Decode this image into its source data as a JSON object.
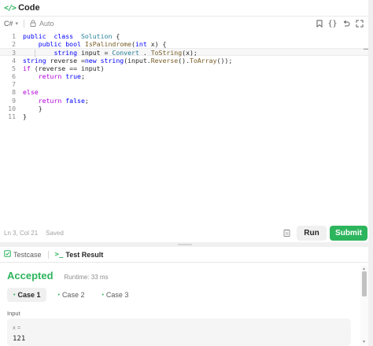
{
  "header": {
    "icon": "code-icon",
    "icon_glyph": "</>",
    "title": "Code"
  },
  "toolbar": {
    "language": "C#",
    "mode": "Auto",
    "icons": [
      "bookmark-icon",
      "braces-icon",
      "undo-icon",
      "expand-icon"
    ]
  },
  "editor": {
    "lines": [
      {
        "n": "1",
        "segs": [
          [
            "kw",
            "public"
          ],
          [
            "",
            "  "
          ],
          [
            "kw",
            "class"
          ],
          [
            "",
            "  "
          ],
          [
            "ty",
            "Solution"
          ],
          [
            "",
            " {"
          ]
        ]
      },
      {
        "n": "2",
        "segs": [
          [
            "",
            "    "
          ],
          [
            "kw",
            "public"
          ],
          [
            "",
            " "
          ],
          [
            "kw",
            "bool"
          ],
          [
            "",
            " "
          ],
          [
            "fn",
            "IsPalindrome"
          ],
          [
            "",
            "("
          ],
          [
            "kw",
            "int"
          ],
          [
            "",
            " x) {"
          ]
        ]
      },
      {
        "n": "3",
        "segs": [
          [
            "",
            "        "
          ],
          [
            "kw",
            "string"
          ],
          [
            "",
            " input = "
          ],
          [
            "ty",
            "Convert"
          ],
          [
            "",
            " . "
          ],
          [
            "fn",
            "ToString"
          ],
          [
            "",
            "(x);"
          ]
        ]
      },
      {
        "n": "4",
        "segs": [
          [
            "kw",
            "string"
          ],
          [
            "",
            " reverse ="
          ],
          [
            "kw",
            "new"
          ],
          [
            "",
            " "
          ],
          [
            "kw",
            "string"
          ],
          [
            "",
            "(input."
          ],
          [
            "fn",
            "Reverse"
          ],
          [
            "",
            "()."
          ],
          [
            "fn",
            "ToArray"
          ],
          [
            "",
            "());"
          ]
        ]
      },
      {
        "n": "5",
        "segs": [
          [
            "kw2",
            "if"
          ],
          [
            "",
            " (reverse == input)"
          ]
        ]
      },
      {
        "n": "6",
        "segs": [
          [
            "",
            "    "
          ],
          [
            "kw2",
            "return"
          ],
          [
            "",
            " "
          ],
          [
            "kw",
            "true"
          ],
          [
            "",
            ";"
          ]
        ]
      },
      {
        "n": "7",
        "segs": []
      },
      {
        "n": "8",
        "segs": [
          [
            "kw2",
            "else"
          ]
        ]
      },
      {
        "n": "9",
        "segs": [
          [
            "",
            "    "
          ],
          [
            "kw2",
            "return"
          ],
          [
            "",
            " "
          ],
          [
            "kw",
            "false"
          ],
          [
            "",
            ";"
          ]
        ]
      },
      {
        "n": "10",
        "segs": [
          [
            "",
            "    }"
          ]
        ]
      },
      {
        "n": "11",
        "segs": [
          [
            "",
            "}"
          ]
        ]
      }
    ],
    "active_line": 3
  },
  "status": {
    "position": "Ln 3, Col 21",
    "saved": "Saved"
  },
  "actions": {
    "run": "Run",
    "submit": "Submit"
  },
  "bottom_tabs": {
    "testcase": "Testcase",
    "test_result": "Test Result"
  },
  "result": {
    "status": "Accepted",
    "runtime": "Runtime: 33 ms"
  },
  "cases": [
    "Case 1",
    "Case 2",
    "Case 3"
  ],
  "input": {
    "label": "Input",
    "var": "x =",
    "value": "121"
  },
  "colors": {
    "accent": "#2db55d",
    "keyword": "#0000ff",
    "control": "#af00db",
    "type": "#267f99",
    "function": "#795e26"
  }
}
